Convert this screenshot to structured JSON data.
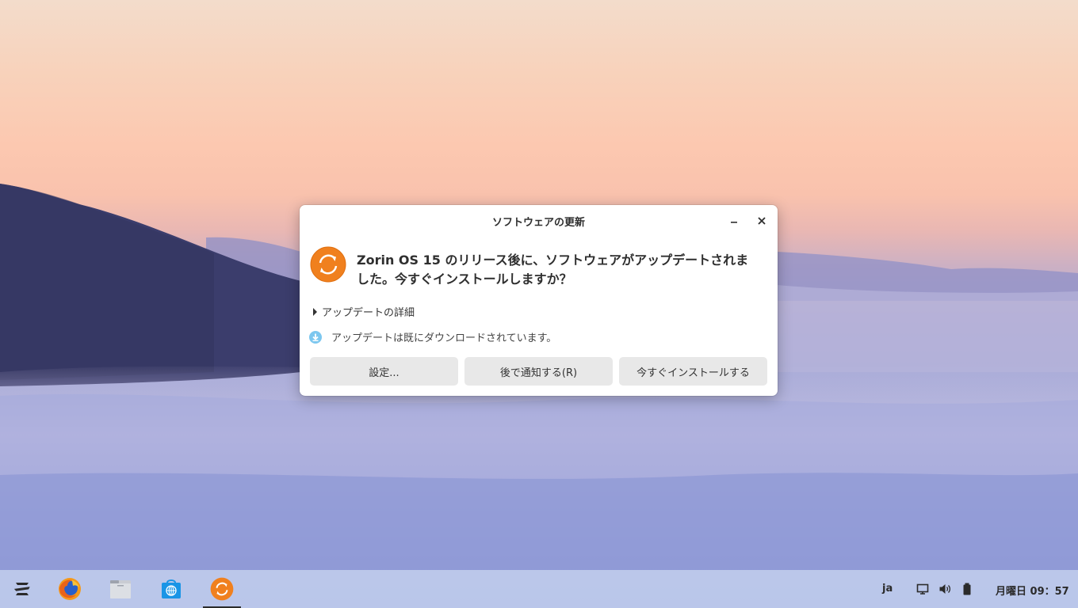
{
  "dialog": {
    "title": "ソフトウェアの更新",
    "headline": "Zorin OS 15 のリリース後に、ソフトウェアがアップデートされました。今すぐインストールしますか？",
    "details_label": "アップデートの詳細",
    "status_text": "アップデートは既にダウンロードされています。",
    "buttons": {
      "settings": "設定...",
      "remind_later": "後で通知する(R)",
      "install_now": "今すぐインストールする"
    }
  },
  "taskbar": {
    "items": [
      {
        "icon": "zorin-menu-icon"
      },
      {
        "icon": "firefox-icon"
      },
      {
        "icon": "files-icon"
      },
      {
        "icon": "software-store-icon"
      },
      {
        "icon": "software-updater-icon",
        "active": true
      }
    ],
    "keyboard_layout": "ja",
    "clock": "月曜日 09：57"
  },
  "colors": {
    "accent_orange": "#f0801e",
    "info_blue": "#7cc7ef"
  }
}
